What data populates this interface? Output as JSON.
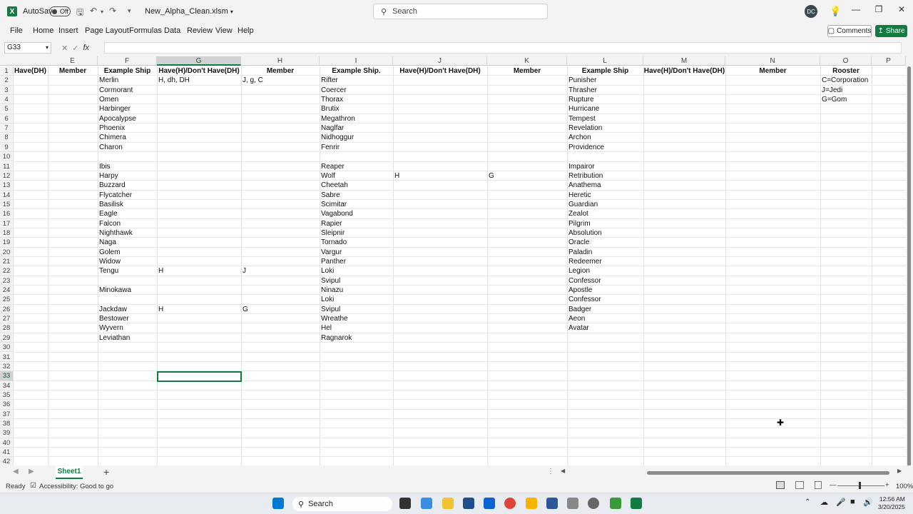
{
  "titlebar": {
    "autosave_label": "AutoSave",
    "autosave_state": "Off",
    "filename": "New_Alpha_Clean.xlsm",
    "search_placeholder": "Search",
    "avatar_initials": "DC"
  },
  "ribbon": {
    "tabs": [
      "File",
      "Home",
      "Insert",
      "Page Layout",
      "Formulas",
      "Data",
      "Review",
      "View",
      "Help"
    ],
    "comments_label": "Comments",
    "share_label": "Share"
  },
  "formula_bar": {
    "name_box": "G33",
    "fx_label": "fx",
    "formula": ""
  },
  "grid": {
    "columns": [
      "E",
      "F",
      "G",
      "H",
      "I",
      "J",
      "K",
      "L",
      "M",
      "N",
      "O",
      "P"
    ],
    "selected_column": "G",
    "selected_row": 33,
    "rows": [
      1,
      2,
      3,
      4,
      5,
      6,
      7,
      8,
      9,
      10,
      11,
      12,
      13,
      14,
      15,
      16,
      17,
      18,
      19,
      20,
      21,
      22,
      23,
      24,
      25,
      26,
      27,
      28,
      29,
      30,
      31,
      32,
      33,
      34,
      35,
      36,
      37,
      38,
      39,
      40,
      41,
      42
    ],
    "header_row": {
      "D": "Have(DH)",
      "E": "Member",
      "F": "Example Ship",
      "G": "Have(H)/Don't Have(DH)",
      "H": "Member",
      "I": "Example Ship.",
      "J": "Have(H)/Don't Have(DH)",
      "K": "Member",
      "L": "Example Ship",
      "M": "Have(H)/Don't Have(DH)",
      "N": "Member",
      "O": "Rooster"
    },
    "col_F": [
      "Merlin",
      "Cormorant",
      "Omen",
      "Harbinger",
      "Apocalypse",
      "Phoenix",
      "Chimera",
      "Charon",
      "",
      "Ibis",
      "Harpy",
      "Buzzard",
      "Flycatcher",
      "Basilisk",
      "Eagle",
      "Falcon",
      "Nighthawk",
      "Naga",
      "Golem",
      "Widow",
      "Tengu",
      "",
      "Minokawa",
      "",
      "Jackdaw",
      "Bestower",
      "Wyvern",
      "Leviathan"
    ],
    "col_I": [
      "Rifter",
      "Coercer",
      "Thorax",
      "Brutix",
      "Megathron",
      "Naglfar",
      "Nidhoggur",
      "Fenrir",
      "",
      "Reaper",
      "Wolf",
      "Cheetah",
      "Sabre",
      "Scimitar",
      "Vagabond",
      "Rapier",
      "Sleipnir",
      "Tornado",
      "Vargur",
      "Panther",
      "Loki",
      "Svipul",
      "Ninazu",
      "Loki",
      "Svipul",
      "Wreathe",
      "Hel",
      "Ragnarok"
    ],
    "col_L": [
      "Punisher",
      "Thrasher",
      "Rupture",
      "Hurricane",
      "Tempest",
      "Revelation",
      "Archon",
      "Providence",
      "",
      "Impairor",
      "Retribution",
      "Anathema",
      "Heretic",
      "Guardian",
      "Zealot",
      "Pilgrim",
      "Absolution",
      "Oracle",
      "Paladin",
      "Redeemer",
      "Legion",
      "Confessor",
      "Apostle",
      "Confessor",
      "Badger",
      "Aeon",
      "Avatar"
    ],
    "col_O": [
      "C=Corporation",
      "J=Jedi",
      "G=Gom"
    ],
    "extra_cells": [
      {
        "col": "G",
        "row": 2,
        "text": "H, dh, DH"
      },
      {
        "col": "H",
        "row": 2,
        "text": "J, g, C"
      },
      {
        "col": "J",
        "row": 12,
        "text": "H"
      },
      {
        "col": "K",
        "row": 12,
        "text": "G"
      },
      {
        "col": "G",
        "row": 22,
        "text": "H"
      },
      {
        "col": "H",
        "row": 22,
        "text": "J"
      },
      {
        "col": "G",
        "row": 26,
        "text": "H"
      },
      {
        "col": "H",
        "row": 26,
        "text": "G"
      }
    ]
  },
  "sheet_tabs": {
    "active": "Sheet1"
  },
  "status": {
    "ready": "Ready",
    "accessibility": "Accessibility: Good to go",
    "zoom": "100%"
  },
  "taskbar": {
    "search_label": "Search",
    "time": "12:56 AM",
    "date": "3/20/2025"
  },
  "colors": {
    "accent": "#107c41",
    "grid_line": "#e1e1e1"
  }
}
